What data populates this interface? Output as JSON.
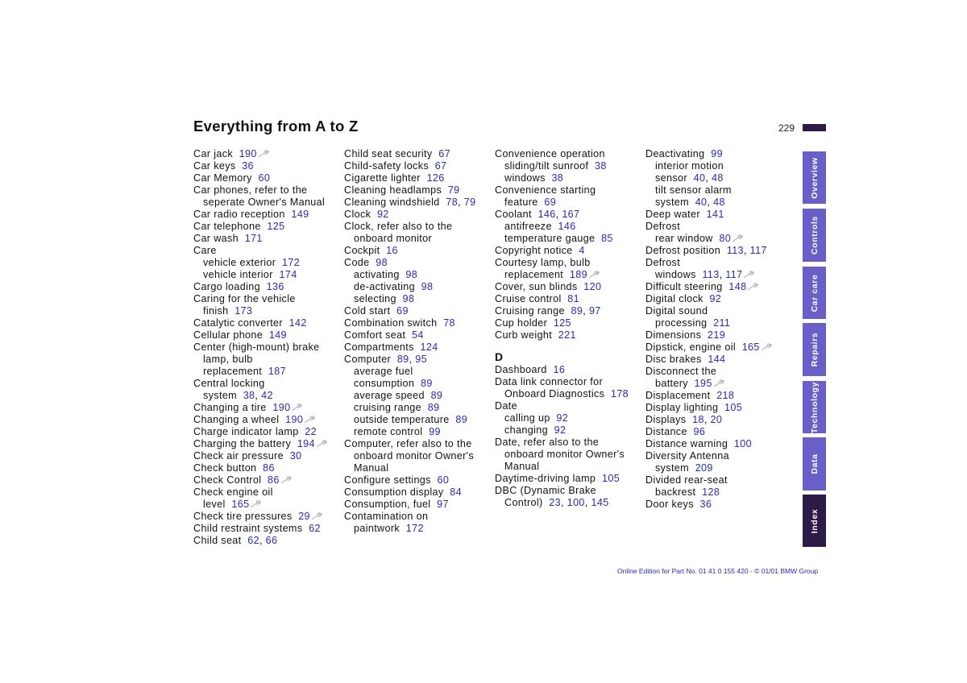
{
  "page": {
    "title": "Everything from A to Z",
    "page_number": "229",
    "footer": "Online Edition for Part No. 01 41 0 155 420 - © 01/01 BMW Group",
    "accent_color": "#6a5fc9",
    "active_color": "#2e1a48",
    "link_color": "#2a2ab8"
  },
  "tabs": [
    {
      "label": "Overview",
      "active": false
    },
    {
      "label": "Controls",
      "active": false
    },
    {
      "label": "Car care",
      "active": false
    },
    {
      "label": "Repairs",
      "active": false
    },
    {
      "label": "Technology",
      "active": false
    },
    {
      "label": "Data",
      "active": false
    },
    {
      "label": "Index",
      "active": true
    }
  ],
  "columns": [
    [
      {
        "text": "Car jack",
        "pages": [
          "190"
        ],
        "wrench": true
      },
      {
        "text": "Car keys",
        "pages": [
          "36"
        ]
      },
      {
        "text": "Car Memory",
        "pages": [
          "60"
        ]
      },
      {
        "text": "Car phones, refer to the"
      },
      {
        "text": "seperate Owner's Manual",
        "sub": true
      },
      {
        "text": "Car radio reception",
        "pages": [
          "149"
        ]
      },
      {
        "text": "Car telephone",
        "pages": [
          "125"
        ]
      },
      {
        "text": "Car wash",
        "pages": [
          "171"
        ]
      },
      {
        "text": "Care"
      },
      {
        "text": "vehicle exterior",
        "pages": [
          "172"
        ],
        "sub": true
      },
      {
        "text": "vehicle interior",
        "pages": [
          "174"
        ],
        "sub": true
      },
      {
        "text": "Cargo loading",
        "pages": [
          "136"
        ]
      },
      {
        "text": "Caring for the vehicle"
      },
      {
        "text": "finish",
        "pages": [
          "173"
        ],
        "sub": true
      },
      {
        "text": "Catalytic converter",
        "pages": [
          "142"
        ]
      },
      {
        "text": "Cellular phone",
        "pages": [
          "149"
        ]
      },
      {
        "text": "Center (high-mount) brake"
      },
      {
        "text": "lamp, bulb",
        "sub": true
      },
      {
        "text": "replacement",
        "pages": [
          "187"
        ],
        "sub": true
      },
      {
        "text": "Central locking"
      },
      {
        "text": "system",
        "pages": [
          "38",
          "42"
        ],
        "sub": true
      },
      {
        "text": "Changing a tire",
        "pages": [
          "190"
        ],
        "wrench": true
      },
      {
        "text": "Changing a wheel",
        "pages": [
          "190"
        ],
        "wrench": true
      },
      {
        "text": "Charge indicator lamp",
        "pages": [
          "22"
        ]
      },
      {
        "text": "Charging the battery",
        "pages": [
          "194"
        ],
        "wrench": true
      },
      {
        "text": "Check air pressure",
        "pages": [
          "30"
        ]
      },
      {
        "text": "Check button",
        "pages": [
          "86"
        ]
      },
      {
        "text": "Check Control",
        "pages": [
          "86"
        ],
        "wrench": true
      },
      {
        "text": "Check engine oil"
      },
      {
        "text": "level",
        "pages": [
          "165"
        ],
        "sub": true,
        "wrench": true
      },
      {
        "text": "Check tire pressures",
        "pages": [
          "29"
        ],
        "wrench": true
      },
      {
        "text": "Child restraint systems",
        "pages": [
          "62"
        ]
      },
      {
        "text": "Child seat",
        "pages": [
          "62",
          "66"
        ]
      }
    ],
    [
      {
        "text": "Child seat security",
        "pages": [
          "67"
        ]
      },
      {
        "text": "Child-safety locks",
        "pages": [
          "67"
        ]
      },
      {
        "text": "Cigarette lighter",
        "pages": [
          "126"
        ]
      },
      {
        "text": "Cleaning headlamps",
        "pages": [
          "79"
        ]
      },
      {
        "text": "Cleaning windshield",
        "pages": [
          "78",
          "79"
        ]
      },
      {
        "text": "Clock",
        "pages": [
          "92"
        ]
      },
      {
        "text": "Clock, refer also to the"
      },
      {
        "text": "onboard monitor",
        "sub": true
      },
      {
        "text": "Cockpit",
        "pages": [
          "16"
        ]
      },
      {
        "text": "Code",
        "pages": [
          "98"
        ]
      },
      {
        "text": "activating",
        "pages": [
          "98"
        ],
        "sub": true
      },
      {
        "text": "de-activating",
        "pages": [
          "98"
        ],
        "sub": true
      },
      {
        "text": "selecting",
        "pages": [
          "98"
        ],
        "sub": true
      },
      {
        "text": "Cold start",
        "pages": [
          "69"
        ]
      },
      {
        "text": "Combination switch",
        "pages": [
          "78"
        ]
      },
      {
        "text": "Comfort seat",
        "pages": [
          "54"
        ]
      },
      {
        "text": "Compartments",
        "pages": [
          "124"
        ]
      },
      {
        "text": "Computer",
        "pages": [
          "89",
          "95"
        ]
      },
      {
        "text": "average fuel",
        "sub": true
      },
      {
        "text": "consumption",
        "pages": [
          "89"
        ],
        "sub": true
      },
      {
        "text": "average speed",
        "pages": [
          "89"
        ],
        "sub": true
      },
      {
        "text": "cruising range",
        "pages": [
          "89"
        ],
        "sub": true
      },
      {
        "text": "outside temperature",
        "pages": [
          "89"
        ],
        "sub": true
      },
      {
        "text": "remote control",
        "pages": [
          "99"
        ],
        "sub": true
      },
      {
        "text": "Computer, refer also to the"
      },
      {
        "text": "onboard monitor Owner's",
        "sub": true
      },
      {
        "text": "Manual",
        "sub": true
      },
      {
        "text": "Configure settings",
        "pages": [
          "60"
        ]
      },
      {
        "text": "Consumption display",
        "pages": [
          "84"
        ]
      },
      {
        "text": "Consumption, fuel",
        "pages": [
          "97"
        ]
      },
      {
        "text": "Contamination on"
      },
      {
        "text": "paintwork",
        "pages": [
          "172"
        ],
        "sub": true
      }
    ],
    [
      {
        "text": "Convenience operation"
      },
      {
        "text": "sliding/tilt sunroof",
        "pages": [
          "38"
        ],
        "sub": true
      },
      {
        "text": "windows",
        "pages": [
          "38"
        ],
        "sub": true
      },
      {
        "text": "Convenience starting"
      },
      {
        "text": "feature",
        "pages": [
          "69"
        ],
        "sub": true
      },
      {
        "text": "Coolant",
        "pages": [
          "146",
          "167"
        ]
      },
      {
        "text": "antifreeze",
        "pages": [
          "146"
        ],
        "sub": true
      },
      {
        "text": "temperature gauge",
        "pages": [
          "85"
        ],
        "sub": true
      },
      {
        "text": "Copyright notice",
        "pages": [
          "4"
        ]
      },
      {
        "text": "Courtesy lamp, bulb"
      },
      {
        "text": "replacement",
        "pages": [
          "189"
        ],
        "sub": true,
        "wrench": true
      },
      {
        "text": "Cover, sun blinds",
        "pages": [
          "120"
        ]
      },
      {
        "text": "Cruise control",
        "pages": [
          "81"
        ]
      },
      {
        "text": "Cruising range",
        "pages": [
          "89",
          "97"
        ]
      },
      {
        "text": "Cup holder",
        "pages": [
          "125"
        ]
      },
      {
        "text": "Curb weight",
        "pages": [
          "221"
        ]
      },
      {
        "letter": "D"
      },
      {
        "text": "Dashboard",
        "pages": [
          "16"
        ]
      },
      {
        "text": "Data link connector for"
      },
      {
        "text": "Onboard Diagnostics",
        "pages": [
          "178"
        ],
        "sub": true
      },
      {
        "text": "Date"
      },
      {
        "text": "calling up",
        "pages": [
          "92"
        ],
        "sub": true
      },
      {
        "text": "changing",
        "pages": [
          "92"
        ],
        "sub": true
      },
      {
        "text": "Date, refer also to the"
      },
      {
        "text": "onboard monitor Owner's",
        "sub": true
      },
      {
        "text": "Manual",
        "sub": true
      },
      {
        "text": "Daytime-driving lamp",
        "pages": [
          "105"
        ]
      },
      {
        "text": "DBC (Dynamic Brake"
      },
      {
        "text": "Control)",
        "pages": [
          "23",
          "100",
          "145"
        ],
        "sub": true
      }
    ],
    [
      {
        "text": "Deactivating",
        "pages": [
          "99"
        ]
      },
      {
        "text": "interior motion",
        "sub": true
      },
      {
        "text": "sensor",
        "pages": [
          "40",
          "48"
        ],
        "sub": true
      },
      {
        "text": "tilt sensor alarm",
        "sub": true
      },
      {
        "text": "system",
        "pages": [
          "40",
          "48"
        ],
        "sub": true
      },
      {
        "text": "Deep water",
        "pages": [
          "141"
        ]
      },
      {
        "text": "Defrost"
      },
      {
        "text": "rear window",
        "pages": [
          "80"
        ],
        "sub": true,
        "wrench": true
      },
      {
        "text": "Defrost position",
        "pages": [
          "113",
          "117"
        ]
      },
      {
        "text": "Defrost"
      },
      {
        "text": "windows",
        "pages": [
          "113",
          "117"
        ],
        "sub": true,
        "wrench": true
      },
      {
        "text": "Difficult steering",
        "pages": [
          "148"
        ],
        "wrench": true
      },
      {
        "text": "Digital clock",
        "pages": [
          "92"
        ]
      },
      {
        "text": "Digital sound"
      },
      {
        "text": "processing",
        "pages": [
          "211"
        ],
        "sub": true
      },
      {
        "text": "Dimensions",
        "pages": [
          "219"
        ]
      },
      {
        "text": "Dipstick, engine oil",
        "pages": [
          "165"
        ],
        "wrench": true
      },
      {
        "text": "Disc brakes",
        "pages": [
          "144"
        ]
      },
      {
        "text": "Disconnect the"
      },
      {
        "text": "battery",
        "pages": [
          "195"
        ],
        "sub": true,
        "wrench": true
      },
      {
        "text": "Displacement",
        "pages": [
          "218"
        ]
      },
      {
        "text": "Display lighting",
        "pages": [
          "105"
        ]
      },
      {
        "text": "Displays",
        "pages": [
          "18",
          "20"
        ]
      },
      {
        "text": "Distance",
        "pages": [
          "96"
        ]
      },
      {
        "text": "Distance warning",
        "pages": [
          "100"
        ]
      },
      {
        "text": "Diversity Antenna"
      },
      {
        "text": "system",
        "pages": [
          "209"
        ],
        "sub": true
      },
      {
        "text": "Divided rear-seat"
      },
      {
        "text": "backrest",
        "pages": [
          "128"
        ],
        "sub": true
      },
      {
        "text": "Door keys",
        "pages": [
          "36"
        ]
      }
    ]
  ]
}
